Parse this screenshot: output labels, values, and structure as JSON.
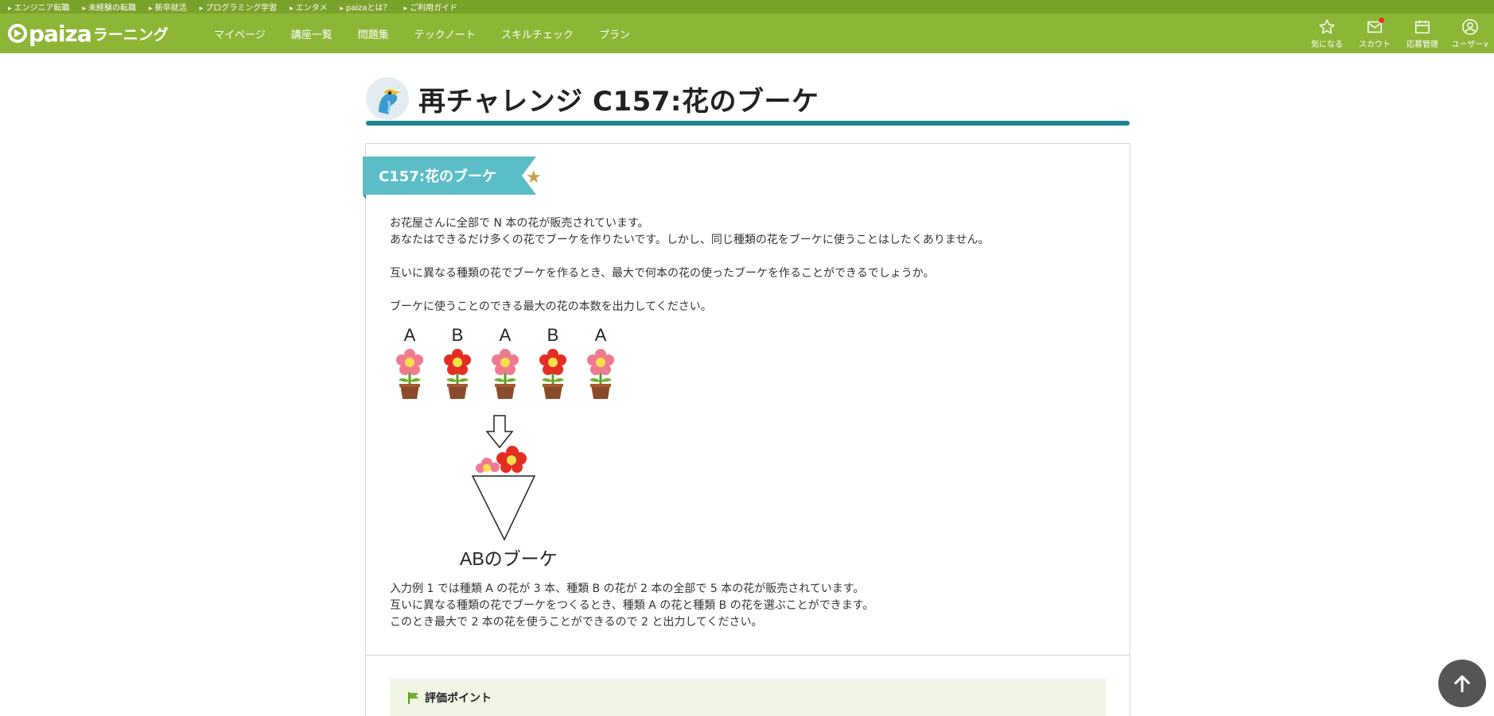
{
  "util_bar": {
    "links": [
      "エンジニア転職",
      "未経験の転職",
      "新卒就活",
      "プログラミング学習",
      "エンタメ",
      "paizaとは？",
      "ご利用ガイド"
    ]
  },
  "nav": {
    "logo_text": "paiza",
    "logo_sub": "ラーニング",
    "menu": [
      "マイページ",
      "講座一覧",
      "問題集",
      "テックノート",
      "スキルチェック",
      "プラン"
    ],
    "right": [
      {
        "label": "気になる",
        "icon": "star-outline-icon"
      },
      {
        "label": "スカウト",
        "icon": "mail-icon"
      },
      {
        "label": "応募管理",
        "icon": "calendar-icon"
      },
      {
        "label": "ユーザー∨",
        "icon": "user-icon"
      }
    ]
  },
  "page": {
    "title": "再チャレンジ C157:花のブーケ"
  },
  "problem": {
    "ribbon_title": "C157:花のブーケ",
    "lines": [
      "お花屋さんに全部で N 本の花が販売されています。",
      "あなたはできるだけ多くの花でブーケを作りたいです。しかし、同じ種類の花をブーケに使うことはしたくありません。",
      "互いに異なる種類の花でブーケを作るとき、最大で何本の花の使ったブーケを作ることができるでしょうか。",
      "ブーケに使うことのできる最大の花の本数を出力してください。"
    ],
    "figure": {
      "letters": [
        "A",
        "B",
        "A",
        "B",
        "A"
      ],
      "bouquet_label": "ABのブーケ"
    },
    "explain": [
      "入力例 1 では種類 A の花が 3 本、種類 B の花が 2 本の全部で 5 本の花が販売されています。",
      "互いに異なる種類の花でブーケをつくるとき、種類 A の花と種類 B の花を選ぶことができます。",
      "このとき最大で 2 本の花を使うことができるので 2 と出力してください。"
    ],
    "eval_title": "評価ポイント"
  },
  "colors": {
    "nav_green": "#8db637",
    "util_green": "#7aa22b",
    "accent_teal": "#1c8491",
    "ribbon": "#5bbdc6",
    "flower_pink": "#f07a8f",
    "flower_red": "#e52d24"
  }
}
